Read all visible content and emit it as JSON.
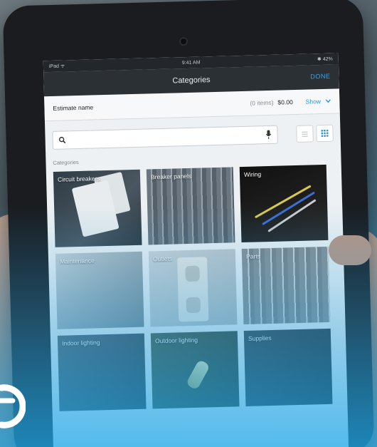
{
  "status_bar": {
    "left": "iPad ᯤ",
    "time": "9:41 AM",
    "right": "✱ 42%"
  },
  "nav": {
    "title": "Categories",
    "done_label": "DONE"
  },
  "estimate": {
    "name_label": "Estimate name",
    "items_label": "(0 items)",
    "total": "$0.00",
    "show_label": "Show"
  },
  "search": {
    "placeholder": ""
  },
  "section_label": "Categories",
  "categories": [
    {
      "label": "Circuit breakers"
    },
    {
      "label": "Breaker panels"
    },
    {
      "label": "Wiring"
    },
    {
      "label": "Maintenance"
    },
    {
      "label": "Outlets"
    },
    {
      "label": "Parts"
    },
    {
      "label": "Indoor lighting"
    },
    {
      "label": "Outdoor lighting"
    },
    {
      "label": "Supplies"
    }
  ],
  "colors": {
    "accent": "#2a97de",
    "overlay": "#1eaaeb"
  },
  "icons": [
    "search-icon",
    "mic-icon",
    "list-view-icon",
    "grid-view-icon",
    "chevron-down-icon",
    "brand-logo-icon"
  ]
}
